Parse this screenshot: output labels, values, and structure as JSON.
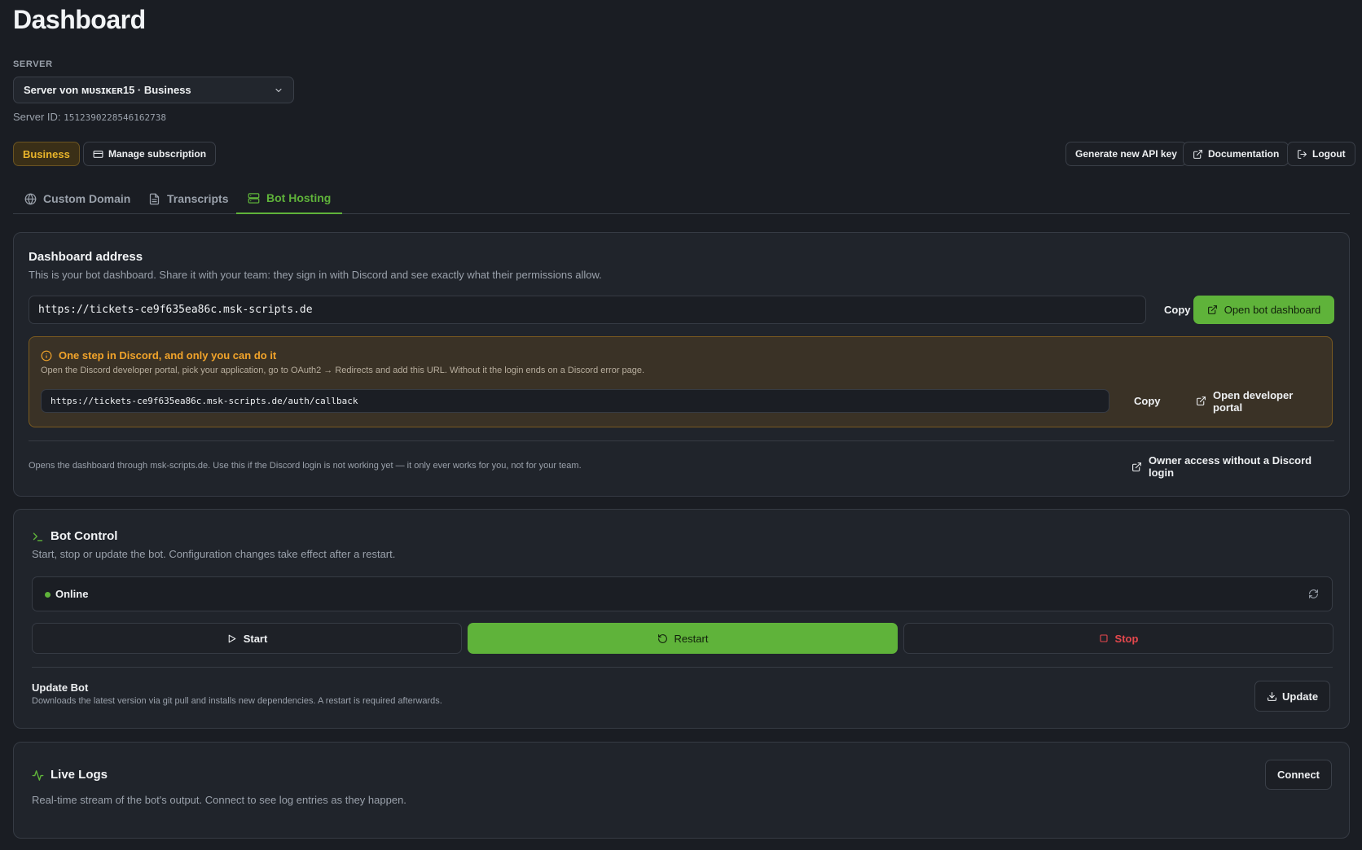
{
  "header": {
    "title": "Dashboard"
  },
  "server": {
    "label": "SERVER",
    "selected": "Server von ᴍᴜsɪᴋᴇʀ15 · Business",
    "id_label": "Server ID:",
    "id_value": "1512390228546162738"
  },
  "toolbar": {
    "plan_badge": "Business",
    "manage_subscription": "Manage subscription",
    "generate_api_key": "Generate new API key",
    "documentation": "Documentation",
    "logout": "Logout"
  },
  "tabs": [
    {
      "label": "Custom Domain",
      "icon": "globe-icon",
      "active": false
    },
    {
      "label": "Transcripts",
      "icon": "file-text-icon",
      "active": false
    },
    {
      "label": "Bot Hosting",
      "icon": "server-icon",
      "active": true
    }
  ],
  "dashboard_address": {
    "title": "Dashboard address",
    "description": "This is your bot dashboard. Share it with your team: they sign in with Discord and see exactly what their permissions allow.",
    "url": "https://tickets-ce9f635ea86c.msk-scripts.de",
    "copy_label": "Copy",
    "open_label": "Open bot dashboard",
    "warning": {
      "title": "One step in Discord, and only you can do it",
      "description": "Open the Discord developer portal, pick your application, go to OAuth2 → Redirects and add this URL. Without it the login ends on a Discord error page.",
      "callback_url": "https://tickets-ce9f635ea86c.msk-scripts.de/auth/callback",
      "copy_label": "Copy",
      "portal_label": "Open developer portal"
    },
    "owner_note": "Opens the dashboard through msk-scripts.de. Use this if the Discord login is not working yet — it only ever works for you, not for your team.",
    "owner_access_label": "Owner access without a Discord login"
  },
  "bot_control": {
    "title": "Bot Control",
    "description": "Start, stop or update the bot. Configuration changes take effect after a restart.",
    "status": "Online",
    "start_label": "Start",
    "restart_label": "Restart",
    "stop_label": "Stop",
    "update_title": "Update Bot",
    "update_description": "Downloads the latest version via git pull and installs new dependencies. A restart is required afterwards.",
    "update_label": "Update"
  },
  "live_logs": {
    "title": "Live Logs",
    "description": "Real-time stream of the bot's output. Connect to see log entries as they happen.",
    "connect_label": "Connect"
  },
  "colors": {
    "background": "#1a1d23",
    "card": "#20242b",
    "accent_green": "#5fb33a",
    "warning_orange": "#f2a42a",
    "business_gold": "#eab52a",
    "stop_red": "#e5484d"
  }
}
